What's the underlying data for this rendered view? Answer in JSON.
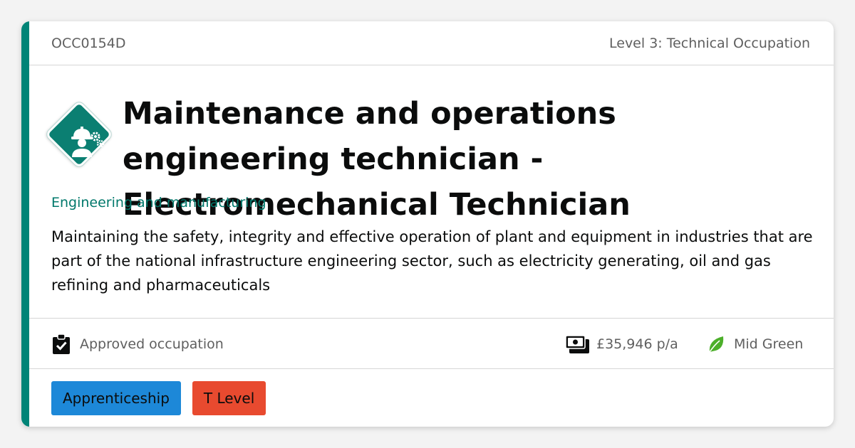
{
  "header": {
    "code": "OCC0154D",
    "level": "Level 3: Technical Occupation"
  },
  "occupation": {
    "icon": "engineer-gears-icon",
    "title": "Maintenance and operations engineering technician - Electromechanical Technician",
    "sector": "Engineering and manufacturing",
    "description": "Maintaining the safety, integrity and effective operation of plant and equipment in industries that are part of the national infrastructure engineering sector, such as electricity generating, oil and gas refining and pharmaceuticals"
  },
  "meta": {
    "status": {
      "icon": "clipboard-check-icon",
      "label": "Approved occupation"
    },
    "salary": {
      "icon": "money-icon",
      "label": "£35,946 p/a"
    },
    "green_rating": {
      "icon": "leaf-icon",
      "label": "Mid Green"
    }
  },
  "tags": [
    {
      "label": "Apprenticeship",
      "color": "#1d88d8"
    },
    {
      "label": "T Level",
      "color": "#e84a2f"
    }
  ],
  "colors": {
    "accent": "#008477",
    "sector_text": "#00786b",
    "leaf": "#4caf2a"
  }
}
